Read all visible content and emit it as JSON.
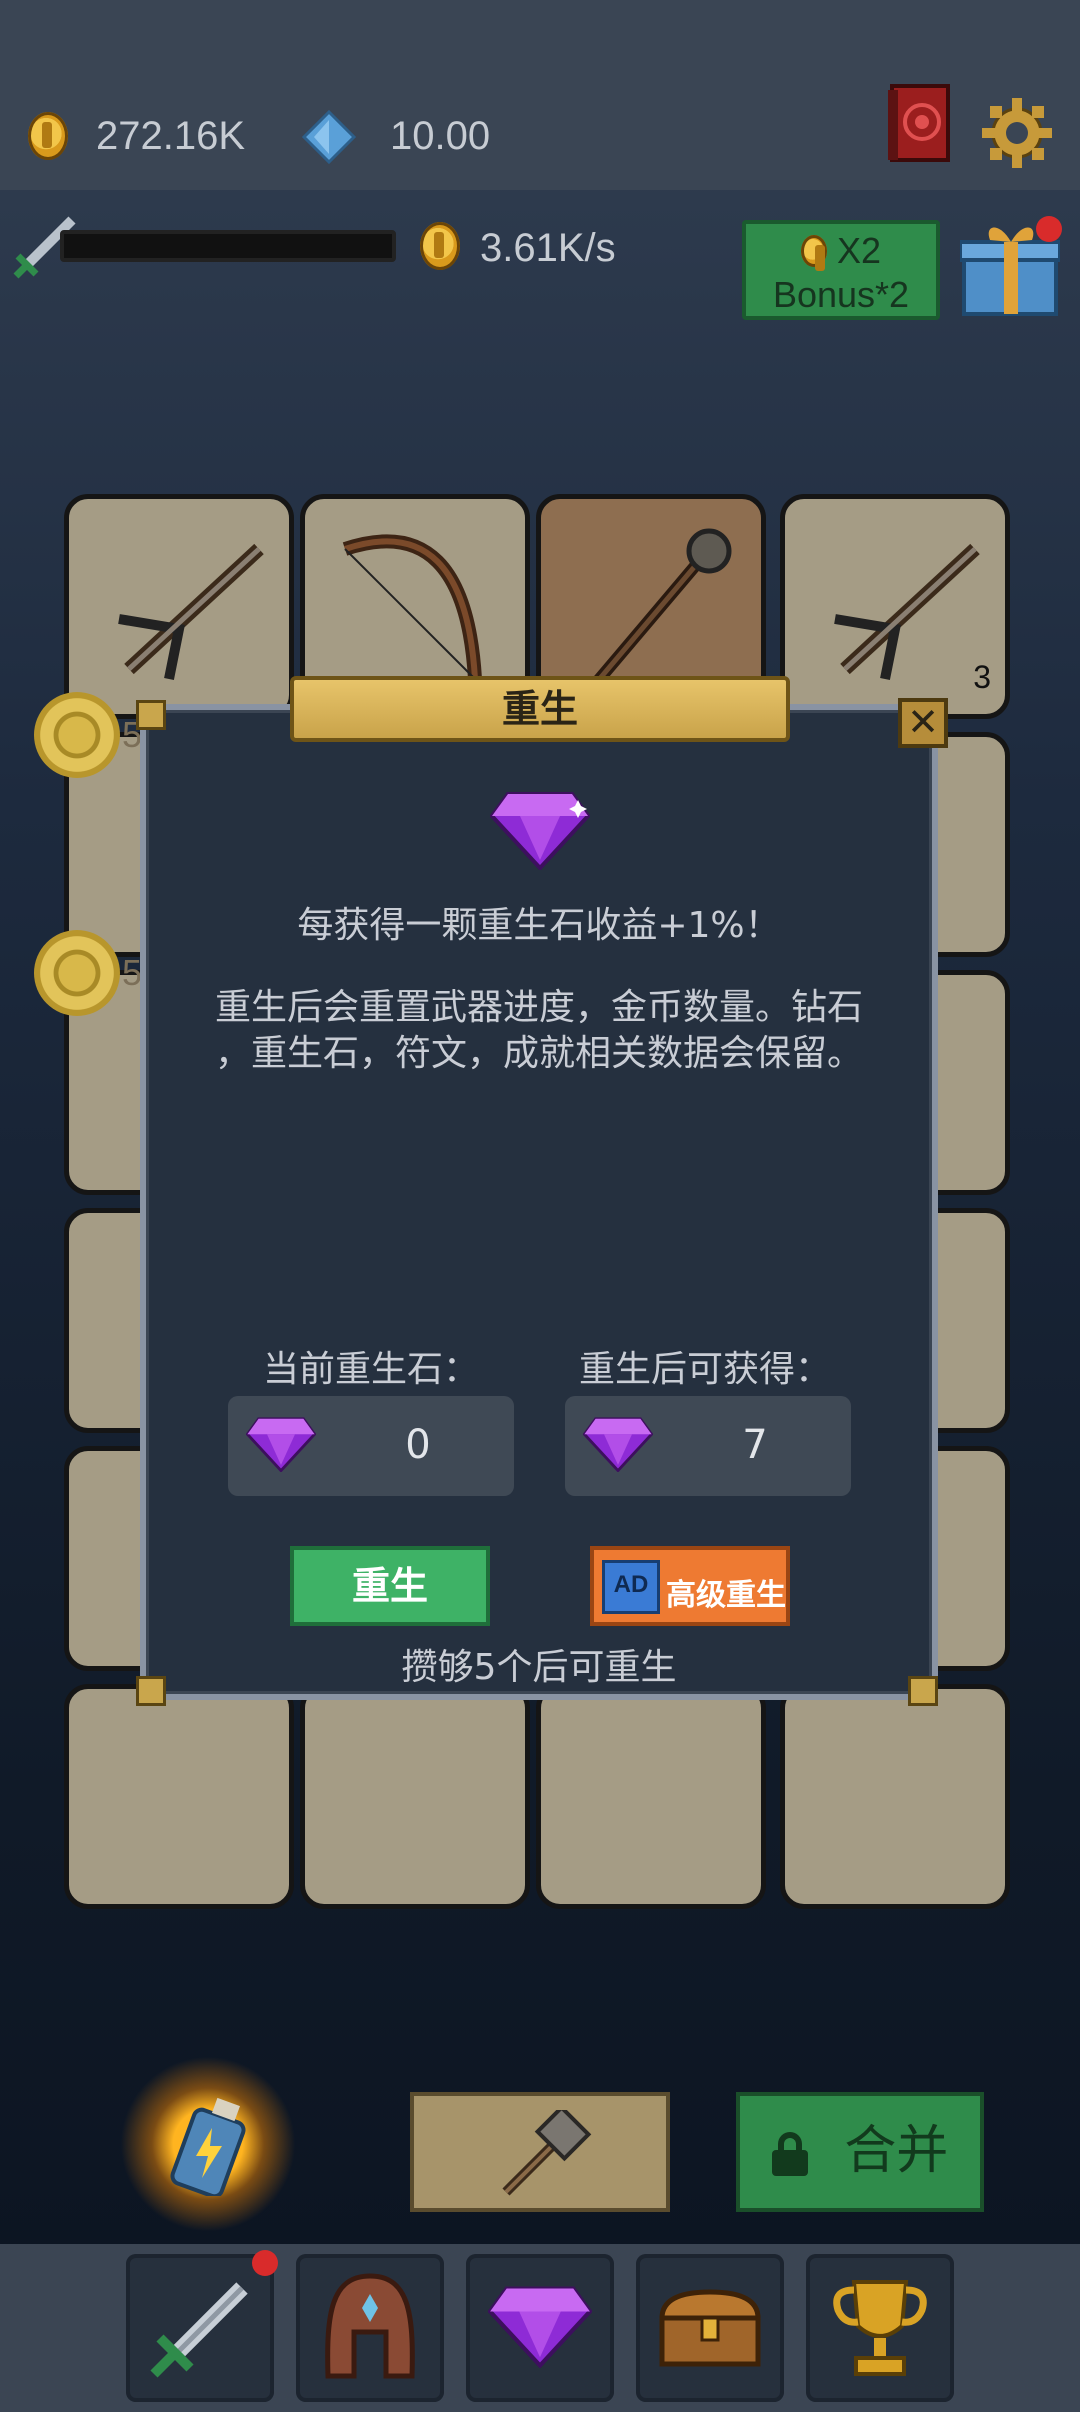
{
  "top": {
    "coins": "272.16K",
    "gems": "10.00",
    "income_rate": "3.61K/s",
    "bonus_line1": "X2",
    "bonus_line2": "Bonus*2",
    "progress": 0
  },
  "grid": {
    "slot_level": "3",
    "side_coin_1_level": "5",
    "side_coin_2_level": "5"
  },
  "dialog": {
    "title": "重生",
    "desc1": "每获得一颗重生石收益+1%！",
    "desc2_line1": "重生后会重置武器进度，金币数量。钻石",
    "desc2_line2": "，重生石，符文，成就相关数据会保留。",
    "current_label": "当前重生石：",
    "after_label": "重生后可获得：",
    "current_value": "0",
    "after_value": "7",
    "rebirth_button": "重生",
    "ad_badge": "AD",
    "advanced_button": "高级重生",
    "hint": "攒够5个后可重生"
  },
  "actions": {
    "merge_label": "合并"
  },
  "colors": {
    "accent_green": "#3eb266",
    "accent_orange": "#ee7a32",
    "gold": "#c9a34a"
  }
}
